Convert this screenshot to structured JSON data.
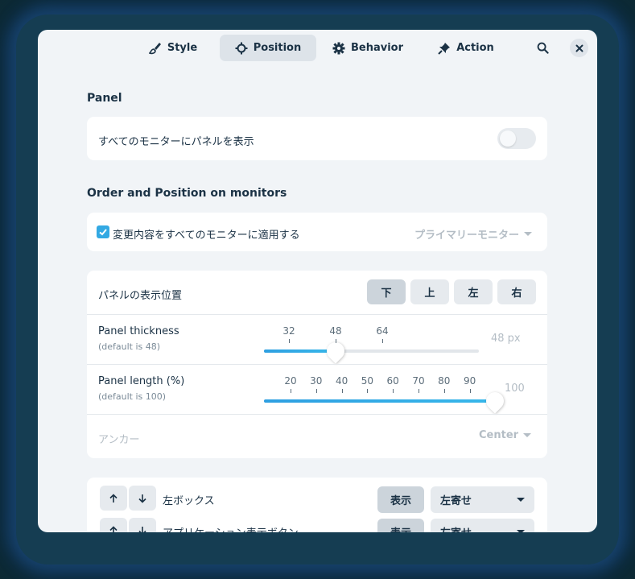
{
  "tabs": [
    {
      "label": "Style",
      "icon": "brush-icon"
    },
    {
      "label": "Position",
      "icon": "crosshair-icon"
    },
    {
      "label": "Behavior",
      "icon": "gear-icon"
    },
    {
      "label": "Action",
      "icon": "pin-icon"
    }
  ],
  "panel": {
    "title": "Panel",
    "show_on_all_monitors": "すべてのモニターにパネルを表示",
    "toggle_on": false
  },
  "order": {
    "title": "Order and Position on monitors",
    "apply_all_label": "変更内容をすべてのモニターに適用する",
    "apply_all_checked": true,
    "monitor_dropdown": "プライマリーモニター",
    "position_label": "パネルの表示位置",
    "positions": [
      "下",
      "上",
      "左",
      "右"
    ],
    "selected_position": "下",
    "thickness": {
      "label": "Panel thickness",
      "default": "(default is 48)",
      "ticks": [
        "32",
        "48",
        "64"
      ],
      "value": 48,
      "value_text": "48 px"
    },
    "length": {
      "label": "Panel length (%)",
      "default": "(default is 100)",
      "ticks": [
        "20",
        "30",
        "40",
        "50",
        "60",
        "70",
        "80",
        "90"
      ],
      "value": 100,
      "value_text": "100"
    },
    "anchor_label": "アンカー",
    "anchor_value": "Center"
  },
  "items": [
    {
      "name": "左ボックス",
      "show": "表示",
      "align": "左寄せ"
    },
    {
      "name": "アプリケーション表示ボタン",
      "show": "表示",
      "align": "左寄せ"
    }
  ],
  "colors": {
    "accent": "#33a9e3"
  }
}
